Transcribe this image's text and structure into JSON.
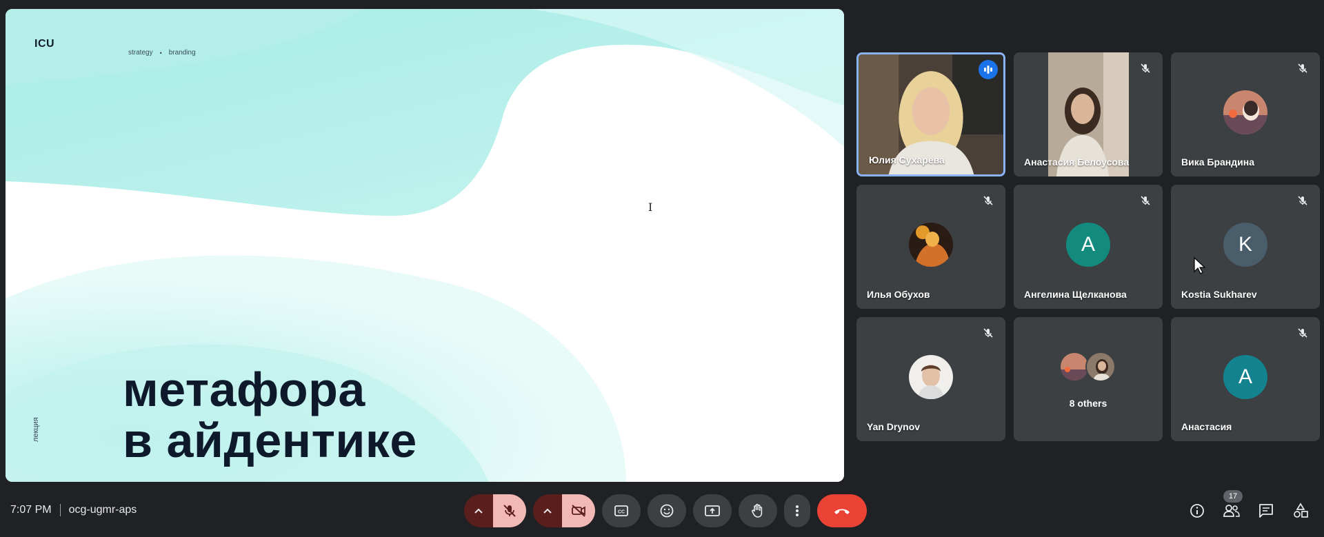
{
  "slide": {
    "logo": "ICU",
    "tag_1": "strategy",
    "tag_sep": "•",
    "tag_2": "branding",
    "title_line_1": "метафора",
    "title_line_2": "в айдентике",
    "side_label": "лекция",
    "cursor_glyph": "I"
  },
  "participants": [
    {
      "name": "Юлия Сухарева",
      "speaking": true
    },
    {
      "name": "Анастасия Белоусова",
      "muted": true
    },
    {
      "name": "Вика Брандина",
      "muted": true
    },
    {
      "name": "Илья Обухов",
      "muted": true
    },
    {
      "name": "Ангелина Щелканова",
      "muted": true,
      "initial": "A",
      "avatar_color": "#138a7e"
    },
    {
      "name": "Kostia Sukharev",
      "muted": true,
      "initial": "K",
      "avatar_color": "#4a5d6b"
    },
    {
      "name": "Yan Drynov",
      "muted": true
    },
    {
      "others_label": "8 others"
    },
    {
      "name": "Анастасия",
      "muted": true,
      "initial": "A",
      "avatar_color": "#12838f"
    }
  ],
  "bottom": {
    "time": "7:07 PM",
    "meeting_code": "ocg-ugmr-aps",
    "participant_count": "17"
  },
  "colors": {
    "end_call": "#ea4335",
    "muted_control": "#f2b8b5",
    "active_tile_border": "#8ab4f8",
    "speaking_badge": "#1a73e8"
  }
}
